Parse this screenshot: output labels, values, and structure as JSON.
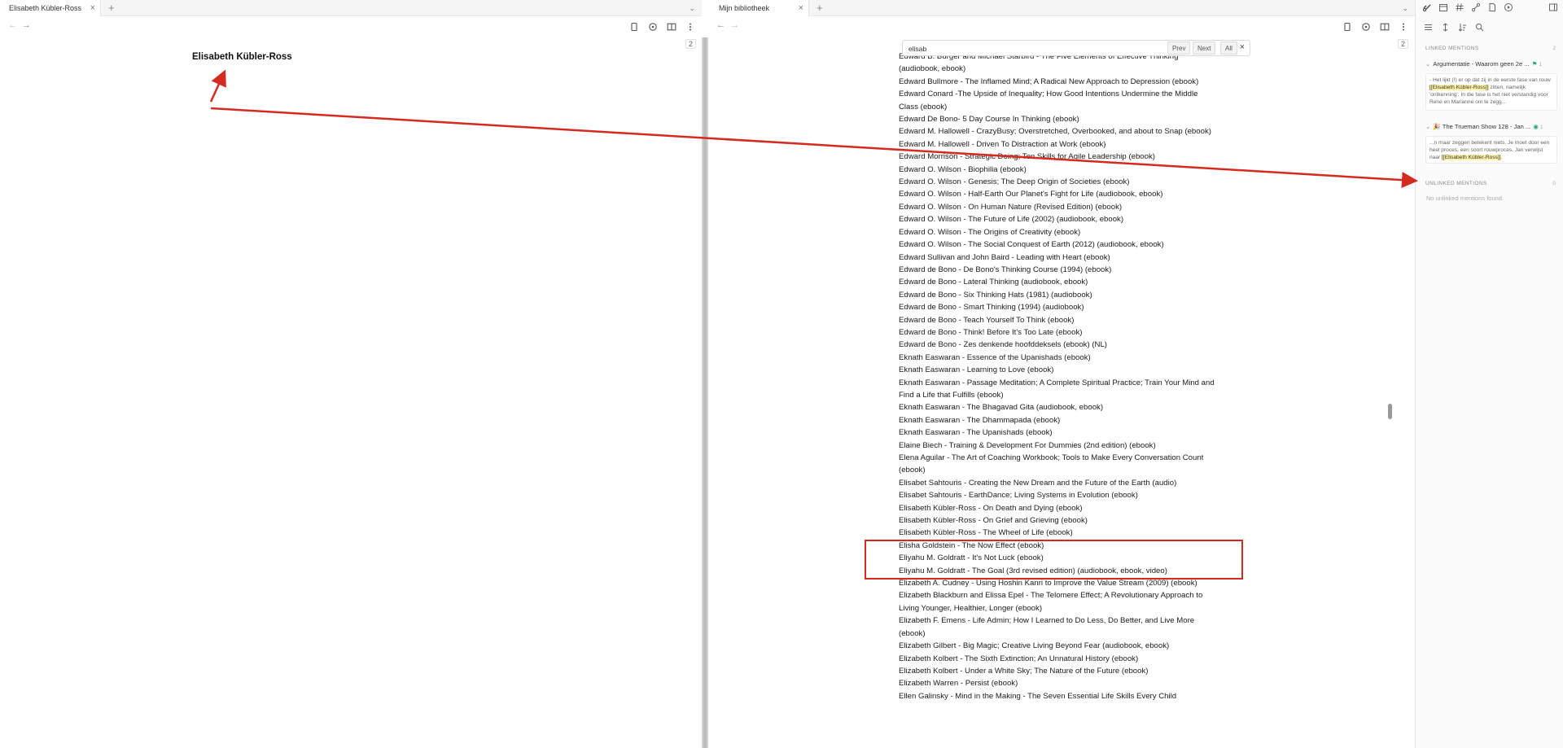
{
  "left_pane": {
    "tab_title": "Elisabeth Kübler-Ross",
    "tab_close": "×",
    "new_tab": "+",
    "tab_list": "⌄",
    "back": "←",
    "forward": "→",
    "page_counter": "2",
    "note_title": "Elisabeth Kübler-Ross"
  },
  "middle_pane": {
    "tab_title": "Mijn bibliotheek",
    "tab_close": "×",
    "new_tab": "+",
    "tab_list": "⌄",
    "back": "←",
    "forward": "→",
    "page_counter": "2",
    "search": {
      "value": "elisab",
      "prev_label": "Prev",
      "next_label": "Next",
      "all_label": "All",
      "close": "×"
    },
    "list_items": [
      "Edward B. Burger and Michael Starbird - The Five Elements of Effective Thinking (audiobook, ebook)",
      "Edward Bullmore - The Inflamed Mind; A Radical New Approach to Depression (ebook)",
      "Edward Conard -The Upside of Inequality; How Good Intentions Undermine the Middle Class (ebook)",
      "Edward De Bono- 5 Day Course In Thinking (ebook)",
      "Edward M. Hallowell - CrazyBusy; Overstretched, Overbooked, and about to Snap (ebook)",
      "Edward M. Hallowell - Driven To Distraction at Work (ebook)",
      "Edward Morrison - Strategic Doing; Ten Skills for Agile Leadership (ebook)",
      "Edward O. Wilson - Biophilia (ebook)",
      "Edward O. Wilson - Genesis; The Deep Origin of Societies (ebook)",
      "Edward O. Wilson - Half-Earth Our Planet's Fight for Life (audiobook, ebook)",
      "Edward O. Wilson - On Human Nature (Revised Edition) (ebook)",
      "Edward O. Wilson - The Future of Life (2002) (audiobook, ebook)",
      "Edward O. Wilson - The Origins of Creativity (ebook)",
      "Edward O. Wilson - The Social Conquest of Earth (2012) (audiobook, ebook)",
      "Edward Sullivan and John Baird - Leading with Heart (ebook)",
      "Edward de Bono - De Bono's Thinking Course (1994) (ebook)",
      "Edward de Bono - Lateral Thinking (audiobook, ebook)",
      "Edward de Bono - Six Thinking Hats (1981) (audiobook)",
      "Edward de Bono - Smart Thinking (1994) (audiobook)",
      "Edward de Bono - Teach Yourself To Think (ebook)",
      "Edward de Bono - Think! Before It's Too Late (ebook)",
      "Edward de Bono - Zes denkende hoofddeksels (ebook) (NL)",
      "Eknath Easwaran - Essence of the Upanishads (ebook)",
      "Eknath Easwaran - Learning to Love (ebook)",
      "Eknath Easwaran - Passage Meditation; A Complete Spiritual Practice; Train Your Mind and Find a Life that Fulfills (ebook)",
      "Eknath Easwaran - The Bhagavad Gita (audiobook, ebook)",
      "Eknath Easwaran - The Dhammapada (ebook)",
      "Eknath Easwaran - The Upanishads (ebook)",
      "Elaine Biech - Training & Development For Dummies (2nd edition) (ebook)",
      "Elena Aguilar - The Art of Coaching Workbook; Tools to Make Every Conversation Count (ebook)",
      "Elisabet Sahtouris - Creating the New Dream and the Future of the Earth (audio)",
      "Elisabet Sahtouris - EarthDance; Living Systems in Evolution (ebook)",
      "Elisabeth Kübler-Ross - On Death and Dying (ebook)",
      "Elisabeth Kübler-Ross - On Grief and Grieving (ebook)",
      "Elisabeth Kübler-Ross - The Wheel of Life (ebook)",
      "Elisha Goldstein - The Now Effect (ebook)",
      "Eliyahu M. Goldratt  - It's Not Luck (ebook)",
      "Eliyahu M. Goldratt - The Goal (3rd revised edition) (audiobook, ebook, video)",
      "Elizabeth A. Cudney - Using Hoshin Kanri to Improve the Value Stream (2009) (ebook)",
      "Elizabeth Blackburn and Elissa Epel - The Telomere Effect; A Revolutionary Approach to Living Younger, Healthier, Longer (ebook)",
      "Elizabeth F. Emens - Life Admin; How I Learned to Do Less, Do Better, and Live More (ebook)",
      "Elizabeth Gilbert - Big Magic; Creative Living Beyond Fear (audiobook, ebook)",
      "Elizabeth Kolbert - The Sixth Extinction; An Unnatural History (ebook)",
      "Elizabeth Kolbert - Under a White Sky; The Nature of the Future (ebook)",
      "Elizabeth Warren - Persist (ebook)",
      "Ellen Galinsky - Mind in the Making - The Seven Essential Life Skills Every Child"
    ]
  },
  "sidebar": {
    "linked_mentions_label": "LINKED MENTIONS",
    "linked_count": "2",
    "mention_1": {
      "title": "Argumentatie - Waarom geen 2e ...",
      "count": "1",
      "snippet_before": "- Het lijkt (!) er op dat zij in de eerste fase van rouw ",
      "snippet_link": "[[Elisabeth Kübler-Ross]]",
      "snippet_after": " zitten, namelijk 'ontkenning'. In die fase is het niet verstandig voor Rene en Marianne om te zegg..."
    },
    "mention_2": {
      "title": "🎉 The Trueman Show 128 - Jan ...",
      "count": "1",
      "snippet_before": "...n maar zeggen betekent niets. Je moet door een heel proces, een soort rouwproces. Jan verwijst naar ",
      "snippet_link": "[[Elisabeth Kübler-Ross]]",
      "snippet_after": "."
    },
    "unlinked_mentions_label": "UNLINKED MENTIONS",
    "unlinked_count": "0",
    "no_unlinked": "No unlinked mentions found."
  },
  "colors": {
    "annotation_red": "#d42b20",
    "highlight": "#fff3a8",
    "accent_green": "#2aa37a"
  },
  "icons": [
    "back-arrow-icon",
    "forward-arrow-icon",
    "reading-view-icon",
    "brain-icon",
    "split-view-icon",
    "more-options-icon",
    "backlinks-icon",
    "calendar-icon",
    "tag-icon",
    "graph-icon",
    "file-icon",
    "play-icon",
    "sidebar-toggle-icon",
    "list-icon",
    "sort-icon",
    "search-icon"
  ]
}
